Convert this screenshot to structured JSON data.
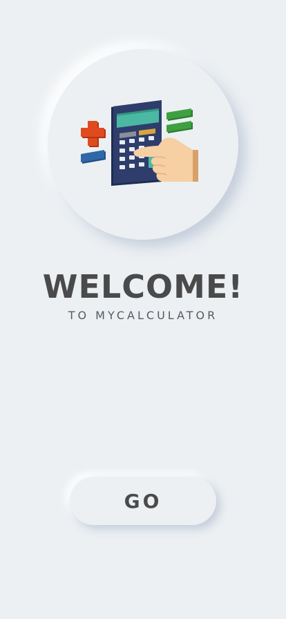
{
  "welcome": {
    "title": "WELCOME!",
    "subtitle": "TO MYCALCULATOR"
  },
  "actions": {
    "go_label": "GO"
  },
  "illustration": {
    "icon": "calculator-hand-icon"
  },
  "colors": {
    "background": "#ecf0f3",
    "text_dark": "#4a4a4a",
    "calculator_body": "#2e3d6b",
    "calculator_screen": "#4bb8a4",
    "plus_red": "#d9441d",
    "minus_blue": "#2f67a8",
    "equals_green": "#3ea041",
    "hand_skin": "#f6cfa2"
  }
}
